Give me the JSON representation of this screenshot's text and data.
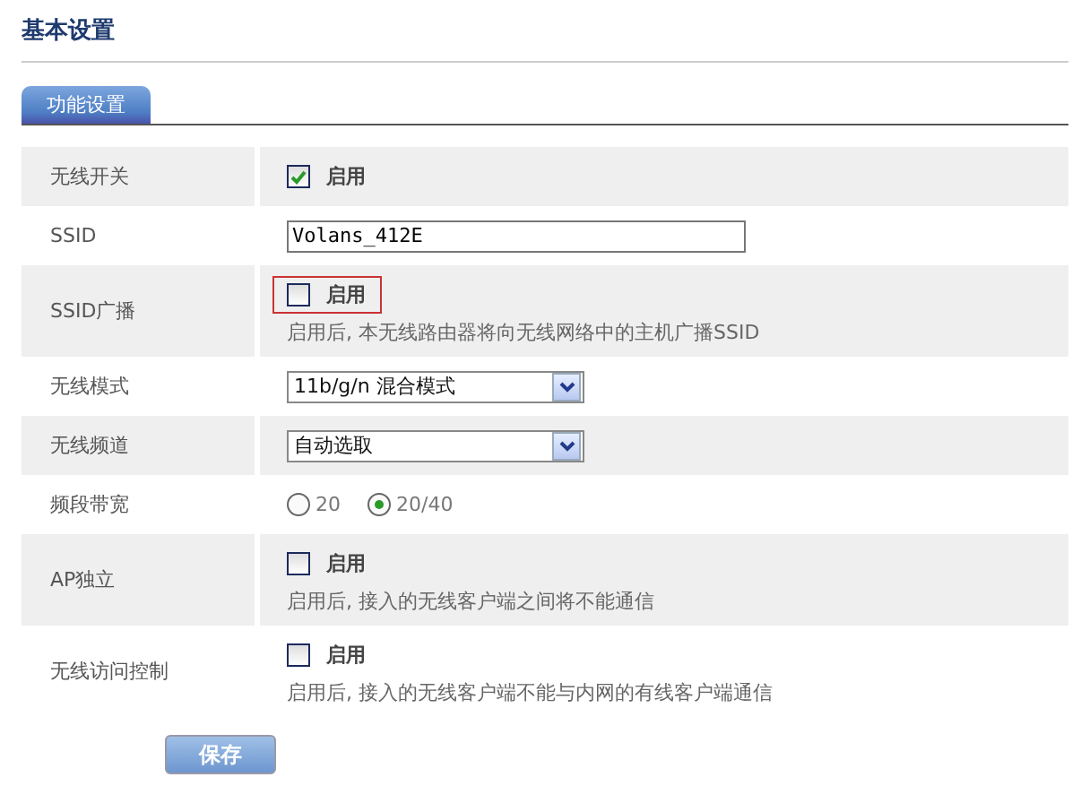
{
  "page_title": "基本设置",
  "tabs": [
    {
      "label": "功能设置",
      "selected": true
    }
  ],
  "rows": [
    {
      "kind": "checkbox",
      "label": "无线开关",
      "option": "启用",
      "checked": true,
      "highlighted": false
    },
    {
      "kind": "text",
      "label": "SSID",
      "value": "Volans_412E"
    },
    {
      "kind": "checkbox",
      "label": "SSID广播",
      "option": "启用",
      "checked": false,
      "highlighted": true,
      "hint": "启用后, 本无线路由器将向无线网络中的主机广播SSID"
    },
    {
      "kind": "select",
      "label": "无线模式",
      "value": "11b/g/n 混合模式"
    },
    {
      "kind": "select",
      "label": "无线频道",
      "value": "自动选取"
    },
    {
      "kind": "radio",
      "label": "频段带宽",
      "options": [
        {
          "label": "20",
          "selected": false
        },
        {
          "label": "20/40",
          "selected": true
        }
      ]
    },
    {
      "kind": "checkbox",
      "label": "AP独立",
      "option": "启用",
      "checked": false,
      "highlighted": false,
      "hint": "启用后, 接入的无线客户端之间将不能通信"
    },
    {
      "kind": "checkbox",
      "label": "无线访问控制",
      "option": "启用",
      "checked": false,
      "highlighted": false,
      "hint": "启用后, 接入的无线客户端不能与内网的有线客户端通信"
    }
  ],
  "save_button": "保存"
}
